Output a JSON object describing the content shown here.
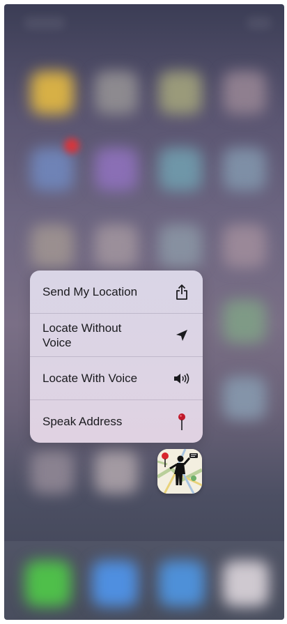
{
  "quick_actions": {
    "items": [
      {
        "label": "Send My Location",
        "icon": "share-icon"
      },
      {
        "label": "Locate Without Voice",
        "icon": "location-arrow-icon"
      },
      {
        "label": "Locate With Voice",
        "icon": "speaker-icon"
      },
      {
        "label": "Speak Address",
        "icon": "pin-icon"
      }
    ]
  },
  "app": {
    "icon": "walking-person-map-app-icon"
  },
  "colors": {
    "menu_background": "#dcd4e5",
    "text": "#1a1a1e",
    "pin_head": "#c0182a"
  }
}
